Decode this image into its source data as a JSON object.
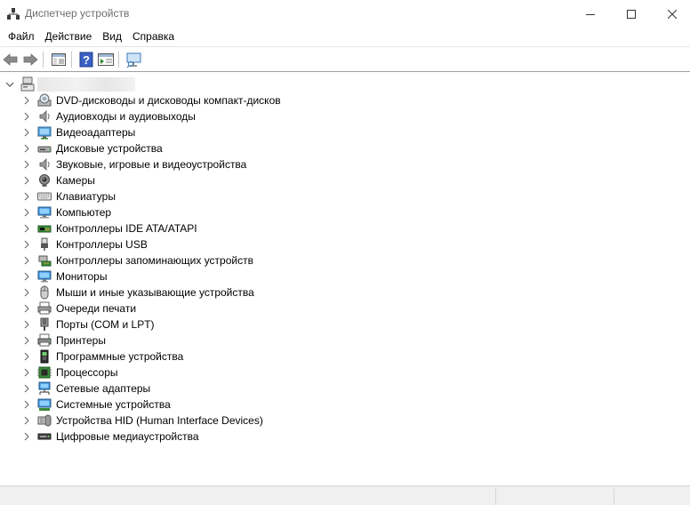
{
  "window": {
    "title": "Диспетчер устройств"
  },
  "menu": {
    "items": [
      "Файл",
      "Действие",
      "Вид",
      "Справка"
    ]
  },
  "toolbar": {
    "buttons": [
      "back-icon",
      "forward-icon",
      "show-hide-console-tree-icon",
      "help-icon",
      "properties-icon",
      "scan-hardware-icon"
    ]
  },
  "tree": {
    "root_label": "",
    "nodes": [
      {
        "label": "DVD-дисководы и дисководы компакт-дисков",
        "icon": "dvd-drive-icon"
      },
      {
        "label": "Аудиовходы и аудиовыходы",
        "icon": "speaker-icon"
      },
      {
        "label": "Видеоадаптеры",
        "icon": "display-adapter-icon"
      },
      {
        "label": "Дисковые устройства",
        "icon": "disk-drive-icon"
      },
      {
        "label": "Звуковые, игровые и видеоустройства",
        "icon": "speaker-icon"
      },
      {
        "label": "Камеры",
        "icon": "camera-icon"
      },
      {
        "label": "Клавиатуры",
        "icon": "keyboard-icon"
      },
      {
        "label": "Компьютер",
        "icon": "computer-icon"
      },
      {
        "label": "Контроллеры IDE ATA/ATAPI",
        "icon": "ide-controller-icon"
      },
      {
        "label": "Контроллеры USB",
        "icon": "usb-icon"
      },
      {
        "label": "Контроллеры запоминающих устройств",
        "icon": "storage-controller-icon"
      },
      {
        "label": "Мониторы",
        "icon": "monitor-icon"
      },
      {
        "label": "Мыши и иные указывающие устройства",
        "icon": "mouse-icon"
      },
      {
        "label": "Очереди печати",
        "icon": "print-queue-icon"
      },
      {
        "label": "Порты (COM и LPT)",
        "icon": "port-icon"
      },
      {
        "label": "Принтеры",
        "icon": "printer-icon"
      },
      {
        "label": "Программные устройства",
        "icon": "software-device-icon"
      },
      {
        "label": "Процессоры",
        "icon": "processor-icon"
      },
      {
        "label": "Сетевые адаптеры",
        "icon": "network-adapter-icon"
      },
      {
        "label": "Системные устройства",
        "icon": "system-device-icon"
      },
      {
        "label": "Устройства HID (Human Interface Devices)",
        "icon": "hid-icon"
      },
      {
        "label": "Цифровые медиаустройства",
        "icon": "media-device-icon"
      }
    ]
  },
  "colors": {
    "accent": "#2f7fd1",
    "title_text": "#6d6d6d",
    "status_bg": "#f0f0f0"
  }
}
